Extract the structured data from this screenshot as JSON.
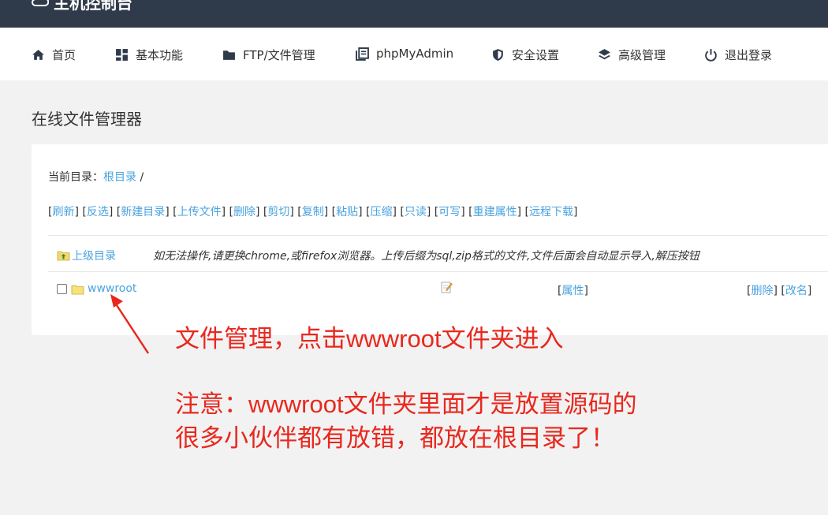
{
  "header": {
    "brand": "主机控制台"
  },
  "nav": {
    "items": [
      {
        "label": "首页",
        "icon": "home-icon"
      },
      {
        "label": "基本功能",
        "icon": "grid-icon"
      },
      {
        "label": "FTP/文件管理",
        "icon": "folder-icon"
      },
      {
        "label": "phpMyAdmin",
        "icon": "database-icon"
      },
      {
        "label": "安全设置",
        "icon": "shield-icon"
      },
      {
        "label": "高级管理",
        "icon": "layers-icon"
      },
      {
        "label": "退出登录",
        "icon": "power-icon"
      }
    ]
  },
  "page": {
    "title": "在线文件管理器"
  },
  "filemanager": {
    "current_dir_label": "当前目录：",
    "current_dir_link": "根目录",
    "current_dir_suffix": "/",
    "actions": [
      "刷新",
      "反选",
      "新建目录",
      "上传文件",
      "删除",
      "剪切",
      "复制",
      "粘贴",
      "压缩",
      "只读",
      "可写",
      "重建属性",
      "远程下载"
    ],
    "parent_dir": "上级目录",
    "hint": "如无法操作,请更换chrome,或firefox浏览器。上传后缀为sql,zip格式的文件,文件后面会自动显示导入,解压按钮",
    "files": [
      {
        "name": "wwwroot",
        "attr_label": "属性",
        "delete_label": "删除",
        "rename_label": "改名"
      }
    ]
  },
  "annotations": {
    "line1": "文件管理，点击wwwroot文件夹进入",
    "line2": "注意：wwwroot文件夹里面才是放置源码的",
    "line3": "很多小伙伴都有放错，都放在根目录了！",
    "color": "#e8281e"
  },
  "colors": {
    "topbar": "#2f3a4a",
    "link": "#4aa3df",
    "background": "#f2f2f2"
  }
}
